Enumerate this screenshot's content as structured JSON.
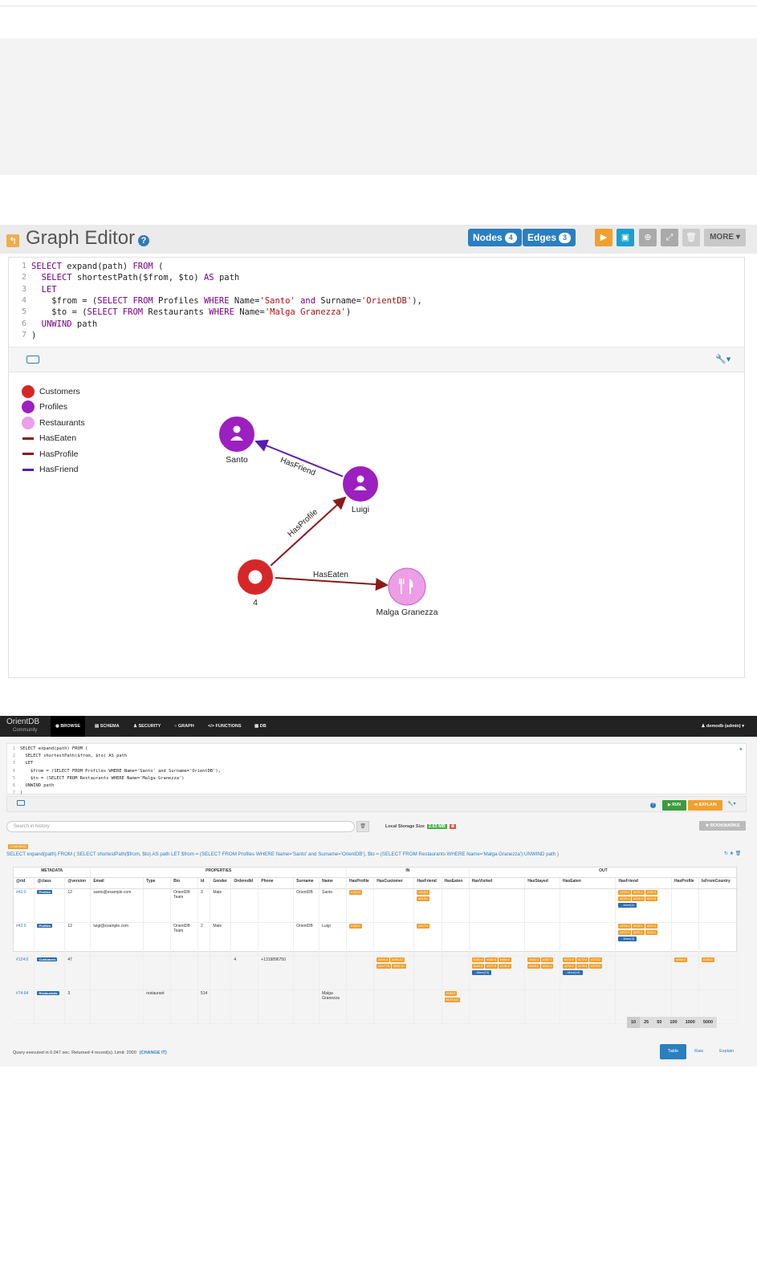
{
  "graph_editor": {
    "title": "Graph Editor",
    "help": "?",
    "nodes_label": "Nodes",
    "nodes_count": "4",
    "edges_label": "Edges",
    "edges_count": "3",
    "more_label": "MORE ▾",
    "query_lines": [
      "SELECT expand(path) FROM (",
      "  SELECT shortestPath($from, $to) AS path",
      "  LET",
      "    $from = (SELECT FROM Profiles WHERE Name='Santo' and Surname='OrientDB'),",
      "    $to = (SELECT FROM Restaurants WHERE Name='Malga Granezza')",
      "  UNWIND path",
      ")"
    ],
    "legend": [
      {
        "label": "Customers",
        "kind": "node",
        "color": "#d62728"
      },
      {
        "label": "Profiles",
        "kind": "node",
        "color": "#9c1fc0"
      },
      {
        "label": "Restaurants",
        "kind": "node",
        "color": "#ec9ee6"
      },
      {
        "label": "HasEaten",
        "kind": "edge",
        "color": "#8b1a1a"
      },
      {
        "label": "HasProfile",
        "kind": "edge",
        "color": "#8b1a1a"
      },
      {
        "label": "HasFriend",
        "kind": "edge",
        "color": "#5a1ab0"
      }
    ],
    "graph_nodes": [
      {
        "label": "Santo",
        "type": "Profiles",
        "icon": "user-icon"
      },
      {
        "label": "Luigi",
        "type": "Profiles",
        "icon": "user-icon"
      },
      {
        "label": "4",
        "type": "Customers",
        "icon": "circle-icon"
      },
      {
        "label": "Malga Granezza",
        "type": "Restaurants",
        "icon": "fork-knife-icon"
      }
    ],
    "graph_edges": [
      {
        "label": "HasFriend",
        "from": "Luigi",
        "to": "Santo"
      },
      {
        "label": "HasProfile",
        "from": "4",
        "to": "Luigi"
      },
      {
        "label": "HasEaten",
        "from": "4",
        "to": "Malga Granezza"
      }
    ]
  },
  "studio": {
    "logo": "OrientDB",
    "logo_sub": "Community",
    "nav": [
      "BROWSE",
      "SCHEMA",
      "SECURITY",
      "GRAPH",
      "FUNCTIONS",
      "DB"
    ],
    "user": "demodb (admin) ▾",
    "query_lines": [
      "SELECT expand(path) FROM (",
      "  SELECT shortestPath($from, $to) AS path",
      "  LET",
      "    $from = (SELECT FROM Profiles WHERE Name='Santo' and Surname='OrientDB'),",
      "    $to = (SELECT FROM Restaurants WHERE Name='Malga Granezza')",
      "  UNWIND path",
      ")"
    ],
    "run": "▶ RUN",
    "explain": "EXPLAIN",
    "search_placeholder": "Search in history",
    "storage_label": "Local Storage Size",
    "storage_size": "2.63 MB",
    "bookmarks": "★ BOOKMARKS",
    "command_badge": "COMMAND",
    "command_text": "SELECT expand(path) FROM ( SELECT shortestPath($from, $to) AS path LET $from = (SELECT FROM Profiles WHERE Name='Santo' and Surname='OrientDB'), $to = (SELECT FROM Restaurants WHERE Name='Malga Granezza') UNWIND path )",
    "groups": {
      "metadata": "METADATA",
      "properties": "PROPERTIES",
      "in": "IN",
      "out": "OUT"
    },
    "columns": [
      "@rid",
      "@class",
      "@version",
      "Email",
      "Type",
      "Bio",
      "Id",
      "Gender",
      "OrderedId",
      "Phone",
      "Surname",
      "Name",
      "HasProfile",
      "HasCustomer",
      "HasFriend",
      "HasEaten",
      "HasVisited",
      "HasStayed",
      "HasEaten",
      "HasFriend",
      "HasProfile",
      "IsFromCountry"
    ],
    "rows": [
      {
        "rid": "#43:0",
        "cls": "Profiles",
        "version": "12",
        "email": "santo@example.com",
        "type": "",
        "bio": "OrientDB Team",
        "id": "3",
        "gender": "Male",
        "orderedid": "",
        "phone": "",
        "surname": "OrientDB",
        "name": "Santo",
        "in_hasprofile": [
          "#100:0"
        ],
        "in_hascustomer": [],
        "in_hasfriend": [
          "#216:0",
          "#218:1"
        ],
        "in_haseaten": [],
        "out_hasvisited": [],
        "out_hasstayed": [],
        "out_haseaten": [],
        "out_hasfriend": [
          "#220:2",
          "#221:0",
          "#222:3",
          "#223:1",
          "#224:3",
          "#217:3"
        ],
        "out_hasfriend_more": "...More(2)",
        "out_hasprofile": [],
        "out_isfromcountry": []
      },
      {
        "rid": "#42:0",
        "cls": "Profiles",
        "version": "12",
        "email": "luigi@example.com",
        "type": "",
        "bio": "OrientDB Team",
        "id": "2",
        "gender": "Male",
        "orderedid": "",
        "phone": "",
        "surname": "OrientDB",
        "name": "Luigi",
        "in_hasprofile": [
          "#100:0"
        ],
        "in_hascustomer": [],
        "in_hasfriend": [
          "#217:0"
        ],
        "in_haseaten": [],
        "out_hasvisited": [],
        "out_hasstayed": [],
        "out_haseaten": [],
        "out_hasfriend": [
          "#218:1",
          "#220:1",
          "#221:1",
          "#222:1",
          "#223:1",
          "#224:1"
        ],
        "out_hasfriend_more": "...More(3)",
        "out_hasprofile": [],
        "out_isfromcountry": []
      },
      {
        "rid": "#124:0",
        "cls": "Customers",
        "version": "47",
        "email": "",
        "type": "",
        "bio": "",
        "id": "",
        "gender": "",
        "orderedid": "4",
        "phone": "+1319896750",
        "surname": "",
        "name": "",
        "in_hasprofile": [],
        "in_hascustomer": [
          "#194:3",
          "#195:42",
          "#197:76",
          "#200:10"
        ],
        "in_hasfriend": [],
        "in_haseaten": [],
        "out_hasvisited": [
          "#181:4",
          "#182:4",
          "#183:4",
          "#184:4",
          "#177:3",
          "#178:3"
        ],
        "out_hasvisited_more": "...More(10)",
        "out_hasstayed": [
          "#161:1",
          "#162:1",
          "#163:1",
          "#164:1"
        ],
        "out_haseaten": [
          "#171:2",
          "#172:2",
          "#173:2",
          "#174:2",
          "#175:3",
          "#176:3"
        ],
        "out_haseaten_more": "...More(14)",
        "out_hasfriend": [],
        "out_hasprofile": [
          "#158:0"
        ],
        "out_isfromcountry": [
          "#146:0"
        ]
      },
      {
        "rid": "#74:64",
        "cls": "Restaurants",
        "version": "3",
        "email": "",
        "type": "restaurant",
        "bio": "",
        "id": "514",
        "gender": "",
        "orderedid": "",
        "phone": "",
        "surname": "",
        "name": "Malga Granezza",
        "in_hasprofile": [],
        "in_hascustomer": [],
        "in_hasfriend": [],
        "in_haseaten": [
          "#168:3",
          "#172:147"
        ],
        "out_hasvisited": [],
        "out_hasstayed": [],
        "out_haseaten": [],
        "out_hasfriend": [],
        "out_hasprofile": [],
        "out_isfromcountry": []
      }
    ],
    "page_sizes": [
      "10",
      "25",
      "50",
      "100",
      "1000",
      "5000"
    ],
    "selected_page_size": "10",
    "footer": "Query executed in 0.047 sec. Returned 4 record(s). Limit: 2000",
    "change_it": "(CHANGE IT)",
    "view_tabs": [
      "Table",
      "Raw",
      "Explain"
    ],
    "selected_view": "Table"
  }
}
